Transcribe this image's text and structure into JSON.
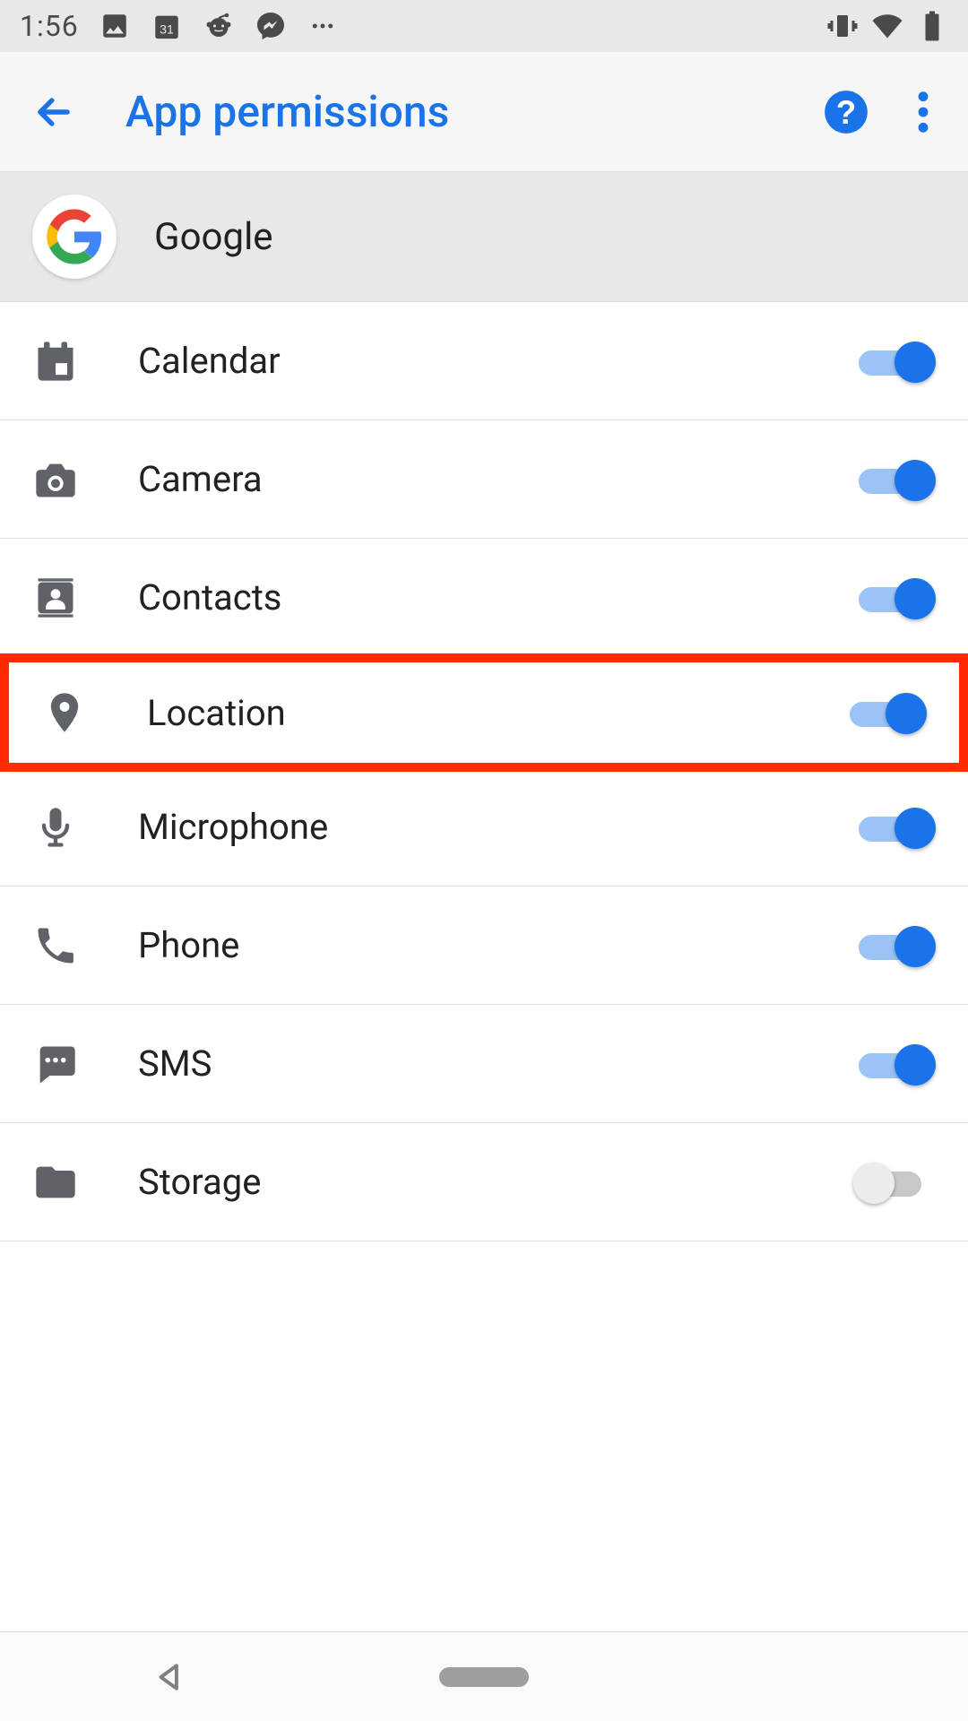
{
  "status": {
    "time": "1:56"
  },
  "appbar": {
    "title": "App permissions"
  },
  "app": {
    "name": "Google"
  },
  "permissions": [
    {
      "id": "calendar",
      "label": "Calendar",
      "icon": "calendar",
      "enabled": true,
      "highlighted": false
    },
    {
      "id": "camera",
      "label": "Camera",
      "icon": "camera",
      "enabled": true,
      "highlighted": false
    },
    {
      "id": "contacts",
      "label": "Contacts",
      "icon": "contacts",
      "enabled": true,
      "highlighted": false
    },
    {
      "id": "location",
      "label": "Location",
      "icon": "location",
      "enabled": true,
      "highlighted": true
    },
    {
      "id": "microphone",
      "label": "Microphone",
      "icon": "microphone",
      "enabled": true,
      "highlighted": false
    },
    {
      "id": "phone",
      "label": "Phone",
      "icon": "phone",
      "enabled": true,
      "highlighted": false
    },
    {
      "id": "sms",
      "label": "SMS",
      "icon": "sms",
      "enabled": true,
      "highlighted": false
    },
    {
      "id": "storage",
      "label": "Storage",
      "icon": "storage",
      "enabled": false,
      "highlighted": false
    }
  ],
  "colors": {
    "accent": "#1a73e8",
    "highlight": "#ff2a00"
  }
}
